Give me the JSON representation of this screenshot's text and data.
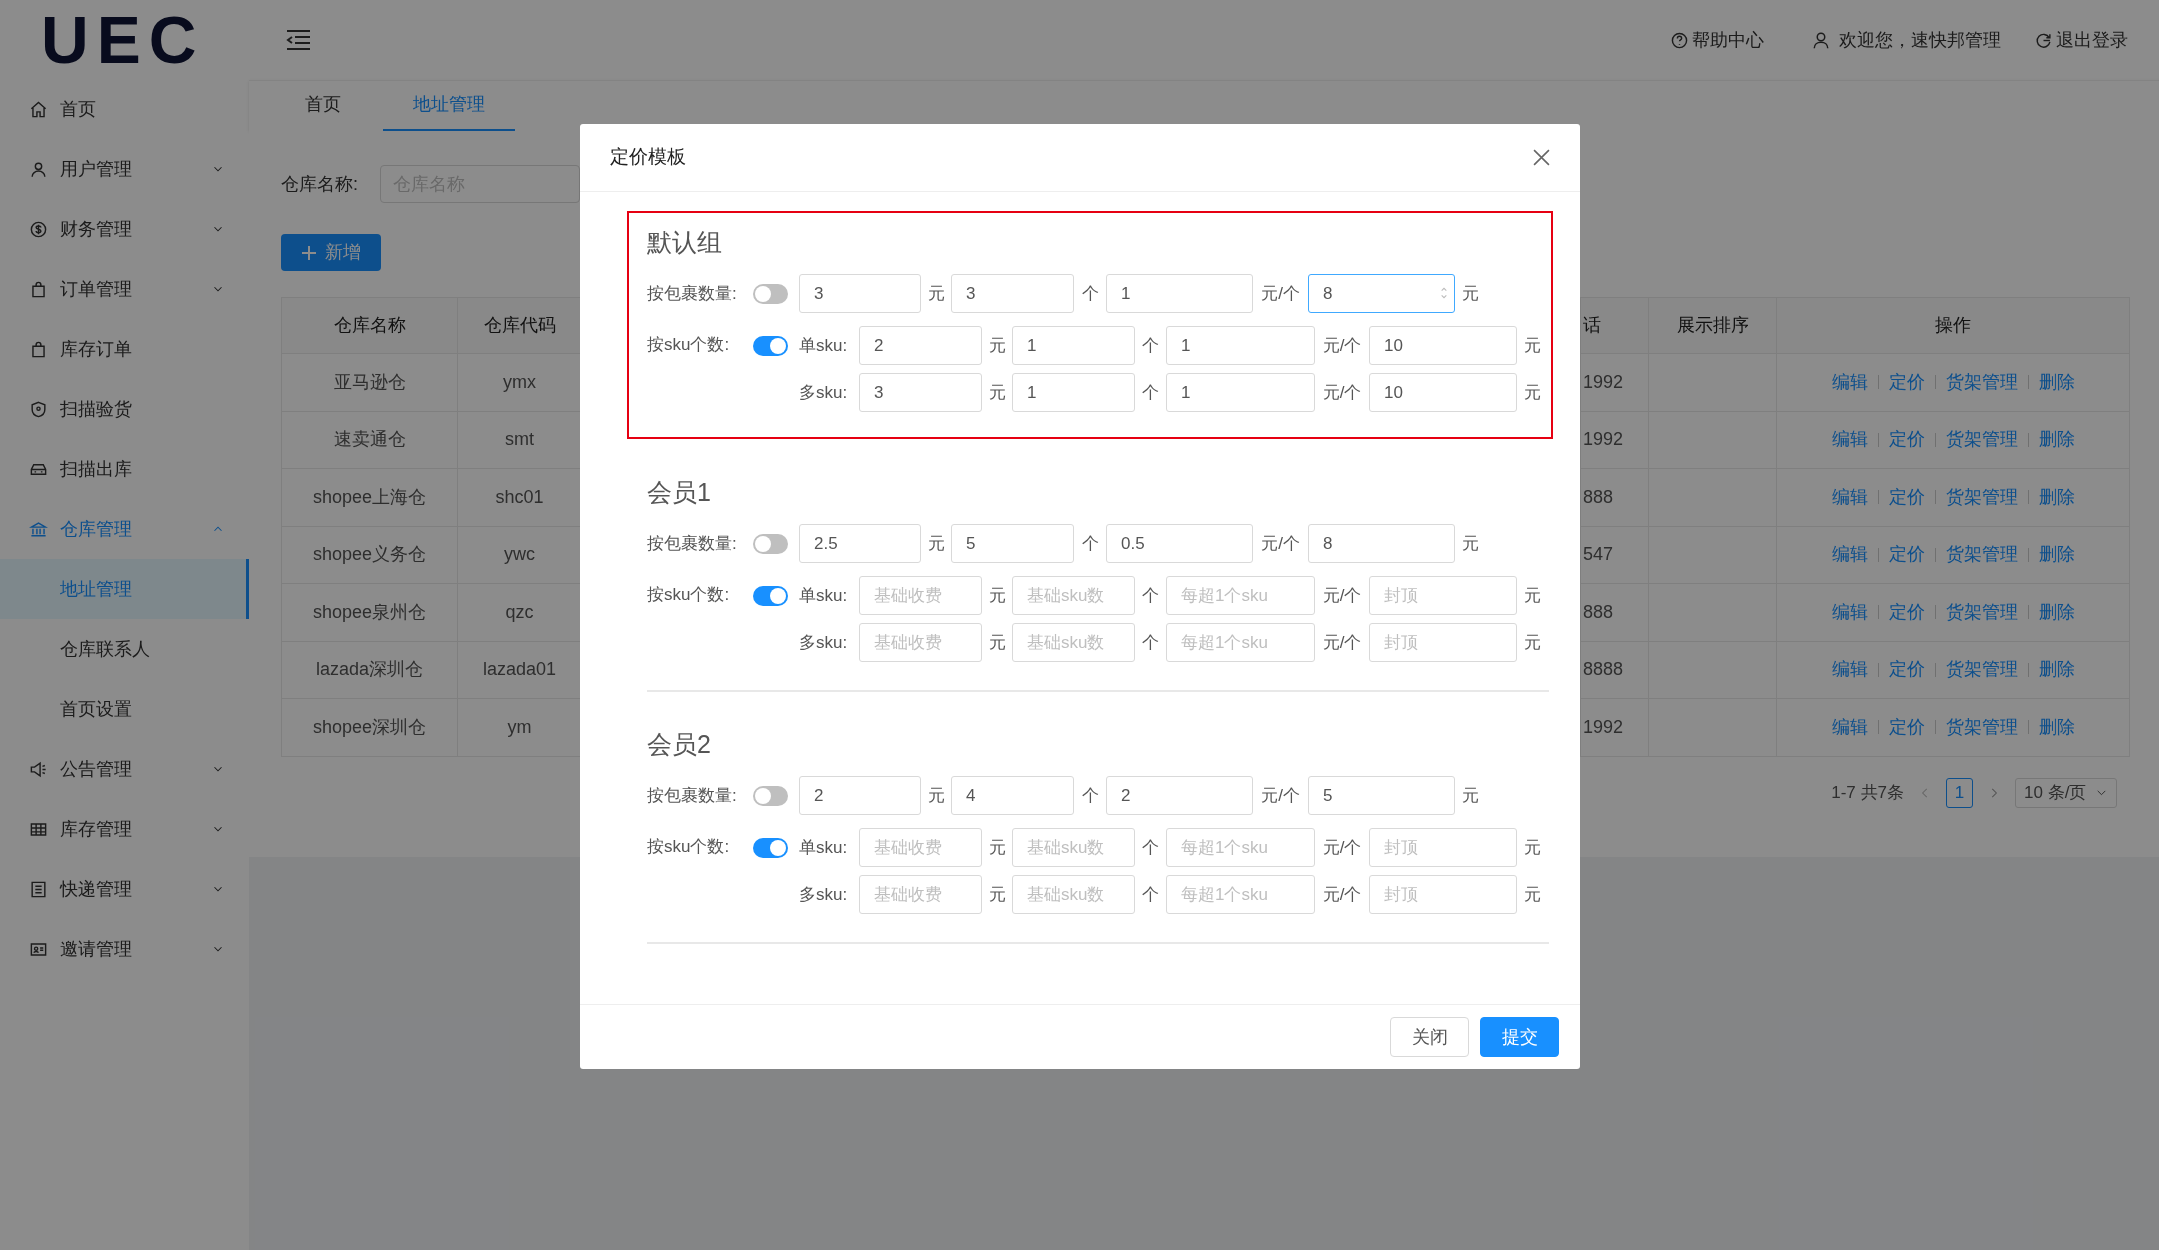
{
  "logo": "UEC",
  "header": {
    "help": "帮助中心",
    "welcome": "欢迎您，速快邦管理",
    "logout": "退出登录"
  },
  "sidebar": {
    "items": [
      {
        "label": "首页",
        "selected": false
      },
      {
        "label": "用户管理",
        "selected": false,
        "expanded": false
      },
      {
        "label": "财务管理",
        "selected": false,
        "expanded": false
      },
      {
        "label": "订单管理",
        "selected": false,
        "expanded": false
      },
      {
        "label": "库存订单",
        "selected": false
      },
      {
        "label": "扫描验货",
        "selected": false
      },
      {
        "label": "扫描出库",
        "selected": false
      },
      {
        "label": "仓库管理",
        "selected": true,
        "expanded": true,
        "children": [
          {
            "label": "地址管理",
            "selected": true
          },
          {
            "label": "仓库联系人",
            "selected": false
          },
          {
            "label": "首页设置",
            "selected": false
          }
        ]
      },
      {
        "label": "公告管理",
        "selected": false,
        "expanded": false
      },
      {
        "label": "库存管理",
        "selected": false,
        "expanded": false
      },
      {
        "label": "快递管理",
        "selected": false,
        "expanded": false
      },
      {
        "label": "邀请管理",
        "selected": false,
        "expanded": false
      }
    ]
  },
  "tabs": [
    {
      "label": "首页",
      "selected": false
    },
    {
      "label": "地址管理",
      "selected": true
    }
  ],
  "search": {
    "label": "仓库名称:",
    "placeholder": "仓库名称"
  },
  "add_button": "新增",
  "table": {
    "columns": [
      "仓库名称",
      "仓库代码",
      "话",
      "展示排序",
      "操作"
    ],
    "rows": [
      {
        "name": "亚马逊仓",
        "code": "ymx",
        "column_3": "1992",
        "actions": [
          "编辑",
          "定价",
          "货架管理",
          "删除"
        ]
      },
      {
        "name": "速卖通仓",
        "code": "smt",
        "column_3": "1992",
        "actions": [
          "编辑",
          "定价",
          "货架管理",
          "删除"
        ]
      },
      {
        "name": "shopee上海仓",
        "code": "shc01",
        "column_3": "888",
        "actions": [
          "编辑",
          "定价",
          "货架管理",
          "删除"
        ]
      },
      {
        "name": "shopee义务仓",
        "code": "ywc",
        "column_3": "547",
        "actions": [
          "编辑",
          "定价",
          "货架管理",
          "删除"
        ]
      },
      {
        "name": "shopee泉州仓",
        "code": "qzc",
        "column_3": "888",
        "actions": [
          "编辑",
          "定价",
          "货架管理",
          "删除"
        ]
      },
      {
        "name": "lazada深圳仓",
        "code": "lazada01",
        "column_3": "8888",
        "actions": [
          "编辑",
          "定价",
          "货架管理",
          "删除"
        ]
      },
      {
        "name": "shopee深圳仓",
        "code": "ym",
        "column_3": "1992",
        "actions": [
          "编辑",
          "定价",
          "货架管理",
          "删除"
        ]
      }
    ]
  },
  "pagination": {
    "total": "1-7 共7条",
    "pages": [
      {
        "label": "1",
        "selected": true
      }
    ],
    "page_size": "10 条/页"
  },
  "modal": {
    "title": "定价模板",
    "groups": [
      {
        "title": "默认组",
        "highlighted": true,
        "by_package": {
          "label": "按包裹数量:",
          "on": false,
          "fields": [
            {
              "value": "3",
              "unit": "元",
              "focused": false
            },
            {
              "value": "3",
              "unit": "个",
              "focused": false
            },
            {
              "value": "1",
              "unit": "元/个",
              "focused": false
            },
            {
              "value": "8",
              "unit": "元",
              "focused": true
            }
          ]
        },
        "by_sku": {
          "label": "按sku个数:",
          "on": true,
          "rows": [
            {
              "label": "单sku:",
              "fields": [
                {
                  "value": "2",
                  "unit": "元"
                },
                {
                  "value": "1",
                  "unit": "个"
                },
                {
                  "value": "1",
                  "unit": "元/个"
                },
                {
                  "value": "10",
                  "unit": "元"
                }
              ]
            },
            {
              "label": "多sku:",
              "fields": [
                {
                  "value": "3",
                  "unit": "元"
                },
                {
                  "value": "1",
                  "unit": "个"
                },
                {
                  "value": "1",
                  "unit": "元/个"
                },
                {
                  "value": "10",
                  "unit": "元"
                }
              ]
            }
          ]
        }
      },
      {
        "title": "会员1",
        "highlighted": false,
        "by_package": {
          "label": "按包裹数量:",
          "on": false,
          "fields": [
            {
              "value": "2.5",
              "unit": "元",
              "focused": false
            },
            {
              "value": "5",
              "unit": "个",
              "focused": false
            },
            {
              "value": "0.5",
              "unit": "元/个",
              "focused": false
            },
            {
              "value": "8",
              "unit": "元",
              "focused": false
            }
          ]
        },
        "by_sku": {
          "label": "按sku个数:",
          "on": true,
          "rows": [
            {
              "label": "单sku:",
              "fields": [
                {
                  "placeholder": "基础收费",
                  "unit": "元"
                },
                {
                  "placeholder": "基础sku数",
                  "unit": "个"
                },
                {
                  "placeholder": "每超1个sku",
                  "unit": "元/个"
                },
                {
                  "placeholder": "封顶",
                  "unit": "元"
                }
              ]
            },
            {
              "label": "多sku:",
              "fields": [
                {
                  "placeholder": "基础收费",
                  "unit": "元"
                },
                {
                  "placeholder": "基础sku数",
                  "unit": "个"
                },
                {
                  "placeholder": "每超1个sku",
                  "unit": "元/个"
                },
                {
                  "placeholder": "封顶",
                  "unit": "元"
                }
              ]
            }
          ]
        }
      },
      {
        "title": "会员2",
        "highlighted": false,
        "by_package": {
          "label": "按包裹数量:",
          "on": false,
          "fields": [
            {
              "value": "2",
              "unit": "元",
              "focused": false
            },
            {
              "value": "4",
              "unit": "个",
              "focused": false
            },
            {
              "value": "2",
              "unit": "元/个",
              "focused": false
            },
            {
              "value": "5",
              "unit": "元",
              "focused": false
            }
          ]
        },
        "by_sku": {
          "label": "按sku个数:",
          "on": true,
          "rows": [
            {
              "label": "单sku:",
              "fields": [
                {
                  "placeholder": "基础收费",
                  "unit": "元"
                },
                {
                  "placeholder": "基础sku数",
                  "unit": "个"
                },
                {
                  "placeholder": "每超1个sku",
                  "unit": "元/个"
                },
                {
                  "placeholder": "封顶",
                  "unit": "元"
                }
              ]
            },
            {
              "label": "多sku:",
              "fields": [
                {
                  "placeholder": "基础收费",
                  "unit": "元"
                },
                {
                  "placeholder": "基础sku数",
                  "unit": "个"
                },
                {
                  "placeholder": "每超1个sku",
                  "unit": "元/个"
                },
                {
                  "placeholder": "封顶",
                  "unit": "元"
                }
              ]
            }
          ]
        }
      }
    ],
    "buttons": [
      {
        "label": "关闭",
        "kind": "secondary"
      },
      {
        "label": "提交",
        "kind": "primary"
      }
    ]
  }
}
